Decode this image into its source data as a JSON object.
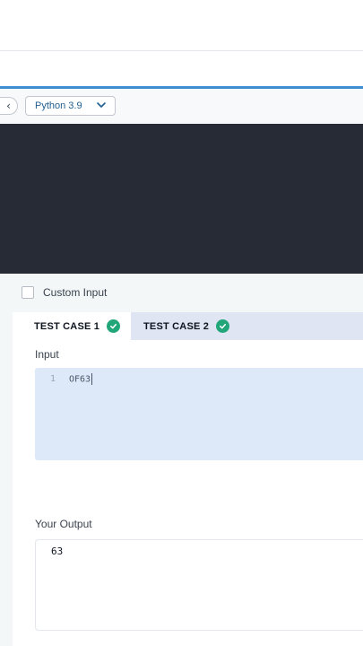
{
  "toolbar": {
    "back_icon": "chevron-left-icon",
    "language": "Python 3.9",
    "language_icon": "chevron-down-icon"
  },
  "custom_input": {
    "label": "Custom Input",
    "checked": false
  },
  "tabs": [
    {
      "label": "TEST CASE 1",
      "status": "passed",
      "active": true
    },
    {
      "label": "TEST CASE 2",
      "status": "passed",
      "active": false
    }
  ],
  "input_section": {
    "label": "Input",
    "line_number": "1",
    "value": "OF63"
  },
  "output_section": {
    "label": "Your Output",
    "value": "63"
  },
  "colors": {
    "accent": "#3d8fd1",
    "success": "#21a67a",
    "editor_bg": "#272b36",
    "input_bg": "#dde8f8"
  }
}
